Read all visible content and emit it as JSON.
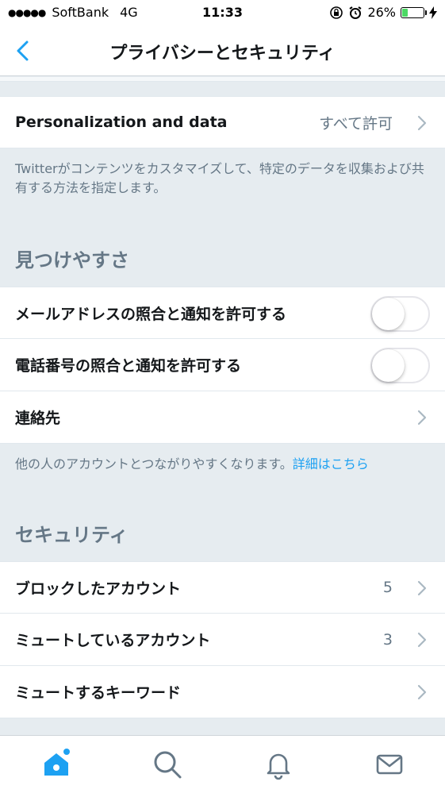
{
  "status_bar": {
    "signal": "●●●●●",
    "carrier": "SoftBank",
    "network": "4G",
    "time": "11:33",
    "battery_percent": "26%",
    "battery_level": 0.26
  },
  "nav": {
    "title": "プライバシーとセキュリティ",
    "back_icon": "chevron-left-icon"
  },
  "personalization": {
    "label": "Personalization and data",
    "value": "すべて許可",
    "description": "Twitterがコンテンツをカスタマイズして、特定のデータを収集および共有する方法を指定します。"
  },
  "discoverability": {
    "header": "見つけやすさ",
    "email_label": "メールアドレスの照合と通知を許可する",
    "email_enabled": false,
    "phone_label": "電話番号の照合と通知を許可する",
    "phone_enabled": false,
    "contacts_label": "連絡先",
    "description": "他の人のアカウントとつながりやすくなります。",
    "learn_more": "詳細はこちら"
  },
  "security": {
    "header": "セキュリティ",
    "blocked_label": "ブロックしたアカウント",
    "blocked_count": "5",
    "muted_label": "ミュートしているアカウント",
    "muted_count": "3",
    "muted_words_label": "ミュートするキーワード"
  },
  "tab_bar": {
    "items": [
      "home-icon",
      "search-icon",
      "bell-icon",
      "mail-icon"
    ],
    "active": "home",
    "accent_color": "#1da1f2",
    "inactive_color": "#657786"
  }
}
